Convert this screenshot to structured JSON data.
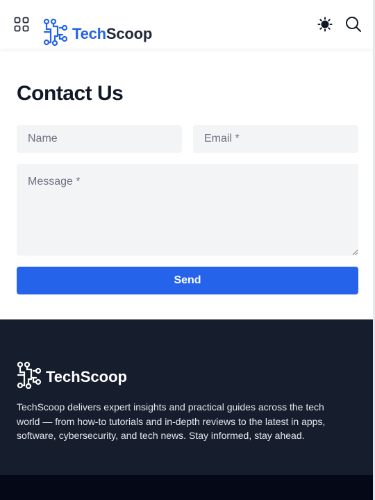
{
  "header": {
    "brand_tech": "Tech",
    "brand_scoop": "Scoop",
    "menu_icon": "grid-icon",
    "theme_icon": "sun-icon",
    "search_icon": "search-icon"
  },
  "contact": {
    "title": "Contact Us",
    "name_placeholder": "Name",
    "email_placeholder": "Email *",
    "message_placeholder": "Message *",
    "send_label": "Send"
  },
  "footer": {
    "brand": "TechScoop",
    "description": "TechScoop delivers expert insights and practical guides across the tech world — from how-to tutorials and in-depth reviews to the latest in apps, software, cybersecurity, and tech news. Stay informed, stay ahead."
  },
  "colors": {
    "accent": "#2563eb",
    "footer_bg": "#161e2e",
    "field_bg": "#f3f4f6"
  }
}
